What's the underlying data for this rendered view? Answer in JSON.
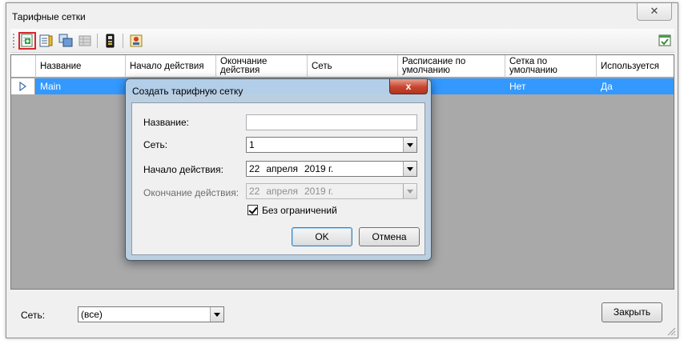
{
  "window": {
    "title": "Тарифные сетки",
    "close_glyph": "✕"
  },
  "toolbar": {
    "buttons": [
      {
        "icon": "add-grid-icon",
        "selected": true
      },
      {
        "icon": "edit-grid-icon"
      },
      {
        "icon": "copy-grid-icon"
      },
      {
        "icon": "delete-grid-icon"
      },
      {
        "icon": "tariff-icon"
      },
      {
        "icon": "properties-icon"
      },
      {
        "icon": "export-icon"
      }
    ]
  },
  "grid": {
    "columns": [
      "Название",
      "Начало действия",
      "Окончание действия",
      "Сеть",
      "Расписание по умолчанию",
      "Сетка по умолчанию",
      "Используется"
    ],
    "rows": [
      {
        "name": "Main",
        "start": "",
        "end": "",
        "network": "",
        "schedule": "",
        "default_grid": "Нет",
        "used": "Да"
      }
    ]
  },
  "footer": {
    "network_label": "Сеть:",
    "network_value": "(все)",
    "close_button": "Закрыть"
  },
  "dialog": {
    "title": "Создать тарифную сетку",
    "close_glyph": "x",
    "name_label": "Название:",
    "name_value": "",
    "network_label": "Сеть:",
    "network_value": "1",
    "start_label": "Начало действия:",
    "start_date": {
      "day": "22",
      "month": "апреля",
      "year": "2019 г."
    },
    "end_label": "Окончание действия:",
    "end_date": {
      "day": "22",
      "month": "апреля",
      "year": "2019 г."
    },
    "unlimited_label": "Без ограничений",
    "unlimited_checked": true,
    "ok_button": "OK",
    "cancel_button": "Отмена"
  }
}
